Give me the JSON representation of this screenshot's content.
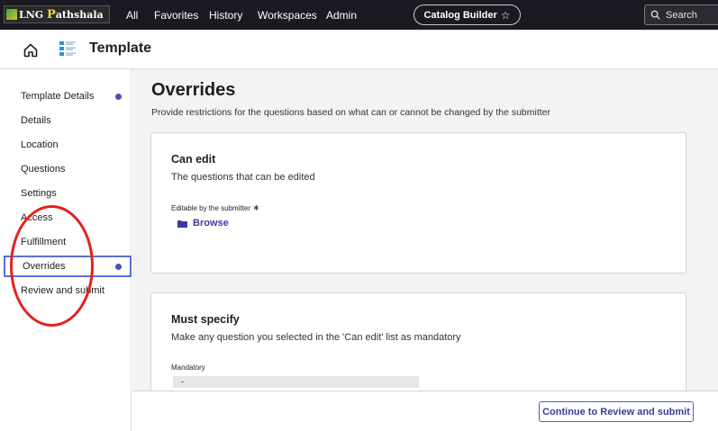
{
  "topnav": {
    "logo_text": "LNG Pathshala",
    "logo_main": "LNG ",
    "logo_accent": "P",
    "logo_rest": "athshala",
    "items": [
      {
        "label": "All"
      },
      {
        "label": "Favorites"
      },
      {
        "label": "History"
      },
      {
        "label": "Workspaces"
      },
      {
        "label": "Admin"
      }
    ],
    "builder_pill": "Catalog Builder",
    "builder_star": "☆",
    "search_label": "Search"
  },
  "header": {
    "title": "Template",
    "icons": [
      "home-icon",
      "template-list-icon"
    ]
  },
  "sidebar": {
    "items": [
      {
        "label": "Template Details",
        "dot": true
      },
      {
        "label": "Details"
      },
      {
        "label": "Location"
      },
      {
        "label": "Questions"
      },
      {
        "label": "Settings"
      },
      {
        "label": "Access"
      },
      {
        "label": "Fulfillment"
      },
      {
        "label": "Overrides",
        "dot": true,
        "active": true
      },
      {
        "label": "Review and submit"
      }
    ]
  },
  "main": {
    "title": "Overrides",
    "description": "Provide restrictions for the questions based on what can or cannot be changed by the submitter",
    "can_edit": {
      "title": "Can edit",
      "subtitle": "The questions that can be edited",
      "field_label": "Editable by the submitter",
      "required_mark": "∗",
      "browse_label": "Browse"
    },
    "must_specify": {
      "title": "Must specify",
      "subtitle": "Make any question you selected in the 'Can edit' list as mandatory",
      "field_label": "Mandatory",
      "field_value": "-"
    }
  },
  "footer": {
    "continue_label": "Continue to Review and submit"
  },
  "colors": {
    "topbar": "#1a1b22",
    "accent": "#4f4fb9",
    "annotation": "#e4211b"
  }
}
